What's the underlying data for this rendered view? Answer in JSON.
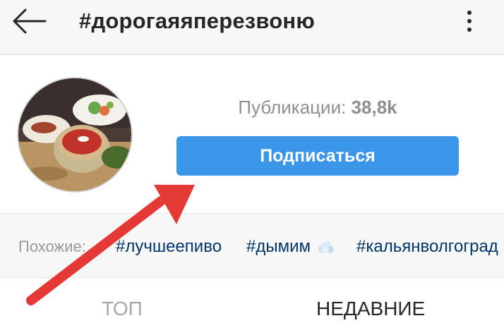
{
  "header": {
    "title": "#дорогаяяперезвоню",
    "back_icon": "arrow-left-icon",
    "more_icon": "more-vertical-icon"
  },
  "profile": {
    "posts_label": "Публикации:",
    "posts_count": "38,8k",
    "follow_label": "Подписаться",
    "follow_color": "#3b96ea"
  },
  "related": {
    "label": "Похожие:",
    "tags": [
      "#лучшеепиво",
      "#дымим",
      "#кальянволгоград"
    ],
    "smoke_icon": "smoke-emoji-icon"
  },
  "tabs": {
    "top_label": "ТОП",
    "recent_label": "НЕДАВНИЕ"
  },
  "annotation": {
    "arrow_color": "#e53935"
  }
}
